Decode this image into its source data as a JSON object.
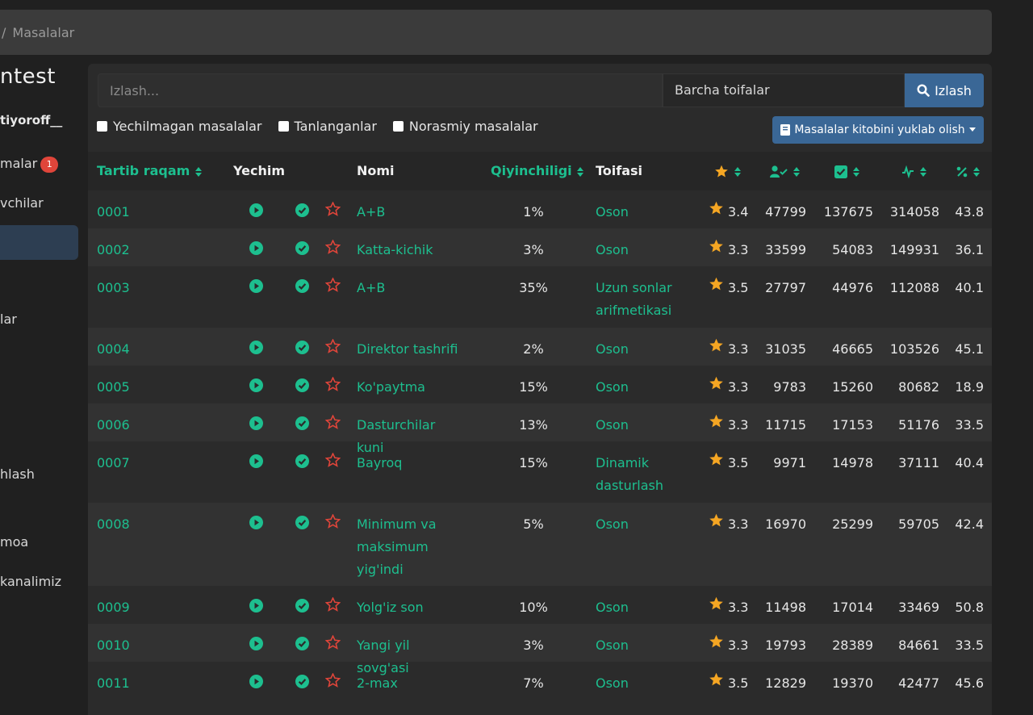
{
  "breadcrumb": {
    "separator": "/",
    "current": "Masalalar"
  },
  "sidebar": {
    "brand": "ntest",
    "user": "tiyoroff__",
    "items": [
      {
        "label": "malar",
        "badge": "1"
      },
      {
        "label": "vchilar"
      },
      {
        "label": "lar"
      },
      {
        "label": "hlash"
      },
      {
        "label": "moa"
      },
      {
        "label": "kanalimiz"
      }
    ]
  },
  "search": {
    "placeholder": "Izlash...",
    "category": "Barcha toifalar",
    "button": "Izlash"
  },
  "filters": [
    "Yechilmagan masalalar",
    "Tanlanganlar",
    "Norasmiy masalalar"
  ],
  "download_button": "Masalalar kitobini yuklab olish",
  "columns": {
    "id": "Tartib raqam",
    "solution": "Yechim",
    "name": "Nomi",
    "difficulty": "Qiyinchiligi",
    "category": "Toifasi"
  },
  "colors": {
    "accent_green": "#1dbf8f",
    "star_red": "#e0453a",
    "star_gold": "#f5a623",
    "button_blue": "#3a6796"
  },
  "problems": [
    {
      "id": "0001",
      "name": "A+B",
      "difficulty": "1%",
      "category": "Oson",
      "rating": "3.4",
      "attempted": "47799",
      "solved": "137675",
      "submissions": "314058",
      "percent": "43.8"
    },
    {
      "id": "0002",
      "name": "Katta-kichik",
      "difficulty": "3%",
      "category": "Oson",
      "rating": "3.3",
      "attempted": "33599",
      "solved": "54083",
      "submissions": "149931",
      "percent": "36.1"
    },
    {
      "id": "0003",
      "name": "A+B",
      "difficulty": "35%",
      "category": "Uzun sonlar arifmetikasi",
      "rating": "3.5",
      "attempted": "27797",
      "solved": "44976",
      "submissions": "112088",
      "percent": "40.1"
    },
    {
      "id": "0004",
      "name": "Direktor tashrifi",
      "difficulty": "2%",
      "category": "Oson",
      "rating": "3.3",
      "attempted": "31035",
      "solved": "46665",
      "submissions": "103526",
      "percent": "45.1"
    },
    {
      "id": "0005",
      "name": "Ko'paytma",
      "difficulty": "15%",
      "category": "Oson",
      "rating": "3.3",
      "attempted": "9783",
      "solved": "15260",
      "submissions": "80682",
      "percent": "18.9"
    },
    {
      "id": "0006",
      "name": "Dasturchilar kuni",
      "difficulty": "13%",
      "category": "Oson",
      "rating": "3.3",
      "attempted": "11715",
      "solved": "17153",
      "submissions": "51176",
      "percent": "33.5"
    },
    {
      "id": "0007",
      "name": "Bayroq",
      "difficulty": "15%",
      "category": "Dinamik dasturlash",
      "rating": "3.5",
      "attempted": "9971",
      "solved": "14978",
      "submissions": "37111",
      "percent": "40.4"
    },
    {
      "id": "0008",
      "name": "Minimum va maksimum yig'indi",
      "difficulty": "5%",
      "category": "Oson",
      "rating": "3.3",
      "attempted": "16970",
      "solved": "25299",
      "submissions": "59705",
      "percent": "42.4"
    },
    {
      "id": "0009",
      "name": "Yolg'iz son",
      "difficulty": "10%",
      "category": "Oson",
      "rating": "3.3",
      "attempted": "11498",
      "solved": "17014",
      "submissions": "33469",
      "percent": "50.8"
    },
    {
      "id": "0010",
      "name": "Yangi yil sovg'asi",
      "difficulty": "3%",
      "category": "Oson",
      "rating": "3.3",
      "attempted": "19793",
      "solved": "28389",
      "submissions": "84661",
      "percent": "33.5"
    },
    {
      "id": "0011",
      "name": "2-max",
      "difficulty": "7%",
      "category": "Oson",
      "rating": "3.5",
      "attempted": "12829",
      "solved": "19370",
      "submissions": "42477",
      "percent": "45.6"
    }
  ]
}
